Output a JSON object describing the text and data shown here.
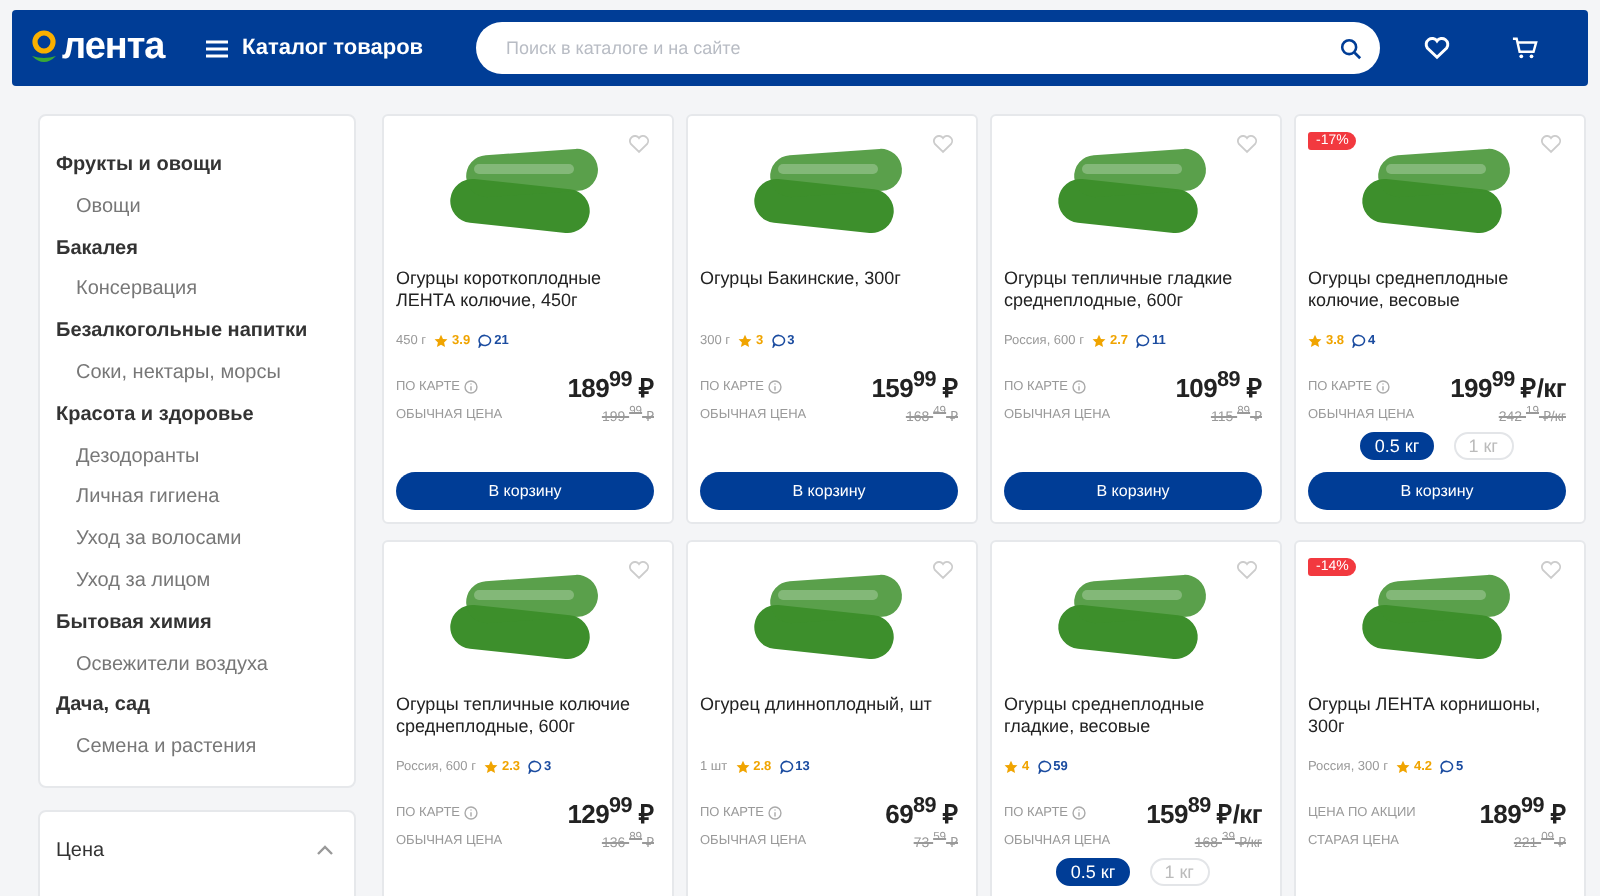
{
  "header": {
    "logo": "лента",
    "catalog": "Каталог товаров",
    "search": {
      "placeholder": "Поиск в каталоге и на сайте"
    }
  },
  "sidebar": {
    "categories": [
      {
        "label": "Фрукты и овощи",
        "children": [
          {
            "label": "Овощи"
          }
        ]
      },
      {
        "label": "Бакалея",
        "children": [
          {
            "label": "Консервация"
          }
        ]
      },
      {
        "label": "Безалкогольные напитки",
        "children": [
          {
            "label": "Соки, нектары, морсы"
          }
        ]
      },
      {
        "label": "Красота и здоровье",
        "children": [
          {
            "label": "Дезодоранты"
          },
          {
            "label": "Личная гигиена"
          },
          {
            "label": "Уход за волосами"
          },
          {
            "label": "Уход за лицом"
          }
        ]
      },
      {
        "label": "Бытовая химия",
        "children": [
          {
            "label": "Освежители воздуха"
          }
        ]
      },
      {
        "label": "Дача, сад",
        "children": [
          {
            "label": "Семена и растения"
          }
        ]
      }
    ],
    "price_filter": {
      "title": "Цена",
      "expanded": true
    }
  },
  "products": [
    {
      "title": "Огурцы короткоплодные ЛЕНТА колючие, 450г",
      "meta": "450 г",
      "rating": "3.9",
      "reviews": "21",
      "price_label": "ПО КАРТЕ",
      "info": true,
      "price": "189",
      "cents": "99",
      "unit": "₽",
      "old_label": "ОБЫЧНАЯ ЦЕНА",
      "old_price": "199",
      "old_cents": "99",
      "old_unit": "₽",
      "button": "В корзину"
    },
    {
      "title": "Огурцы Бакинские, 300г",
      "meta": "300 г",
      "rating": "3",
      "reviews": "3",
      "price_label": "ПО КАРТЕ",
      "info": true,
      "price": "159",
      "cents": "99",
      "unit": "₽",
      "old_label": "ОБЫЧНАЯ ЦЕНА",
      "old_price": "168",
      "old_cents": "49",
      "old_unit": "₽",
      "button": "В корзину"
    },
    {
      "title": "Огурцы тепличные гладкие среднеплодные, 600г",
      "meta": "Россия, 600 г",
      "rating": "2.7",
      "reviews": "11",
      "price_label": "ПО КАРТЕ",
      "info": true,
      "price": "109",
      "cents": "89",
      "unit": "₽",
      "old_label": "ОБЫЧНАЯ ЦЕНА",
      "old_price": "115",
      "old_cents": "89",
      "old_unit": "₽",
      "button": "В корзину"
    },
    {
      "title": "Огурцы среднеплодные колючие, весовые",
      "discount": "-17%",
      "rating": "3.8",
      "reviews": "4",
      "price_label": "ПО КАРТЕ",
      "info": true,
      "price": "199",
      "cents": "99",
      "unit": "₽/кг",
      "old_label": "ОБЫЧНАЯ ЦЕНА",
      "old_price": "242",
      "old_cents": "19",
      "old_unit": "₽/кг",
      "weights": [
        {
          "label": "0.5 кг",
          "selected": true
        },
        {
          "label": "1 кг",
          "selected": false
        }
      ],
      "button": "В корзину"
    },
    {
      "title": "Огурцы тепличные колючие среднеплодные, 600г",
      "meta": "Россия, 600 г",
      "rating": "2.3",
      "reviews": "3",
      "price_label": "ПО КАРТЕ",
      "info": true,
      "price": "129",
      "cents": "99",
      "unit": "₽",
      "old_label": "ОБЫЧНАЯ ЦЕНА",
      "old_price": "136",
      "old_cents": "89",
      "old_unit": "₽"
    },
    {
      "title": "Огурец длинноплодный, шт",
      "meta": "1 шт",
      "rating": "2.8",
      "reviews": "13",
      "price_label": "ПО КАРТЕ",
      "info": true,
      "price": "69",
      "cents": "89",
      "unit": "₽",
      "old_label": "ОБЫЧНАЯ ЦЕНА",
      "old_price": "73",
      "old_cents": "59",
      "old_unit": "₽"
    },
    {
      "title": "Огурцы среднеплодные гладкие, весовые",
      "rating": "4",
      "reviews": "59",
      "price_label": "ПО КАРТЕ",
      "info": true,
      "price": "159",
      "cents": "89",
      "unit": "₽/кг",
      "old_label": "ОБЫЧНАЯ ЦЕНА",
      "old_price": "168",
      "old_cents": "39",
      "old_unit": "₽/кг",
      "weights": [
        {
          "label": "0.5 кг",
          "selected": true
        },
        {
          "label": "1 кг",
          "selected": false
        }
      ]
    },
    {
      "title": "Огурцы ЛЕНТА корнишоны, 300г",
      "discount": "-14%",
      "meta": "Россия, 300 г",
      "rating": "4.2",
      "reviews": "5",
      "price_label": "ЦЕНА ПО АКЦИИ",
      "info": false,
      "price": "189",
      "cents": "99",
      "unit": "₽",
      "old_label": "СТАРАЯ ЦЕНА",
      "old_price": "221",
      "old_cents": "09",
      "old_unit": "₽"
    }
  ]
}
